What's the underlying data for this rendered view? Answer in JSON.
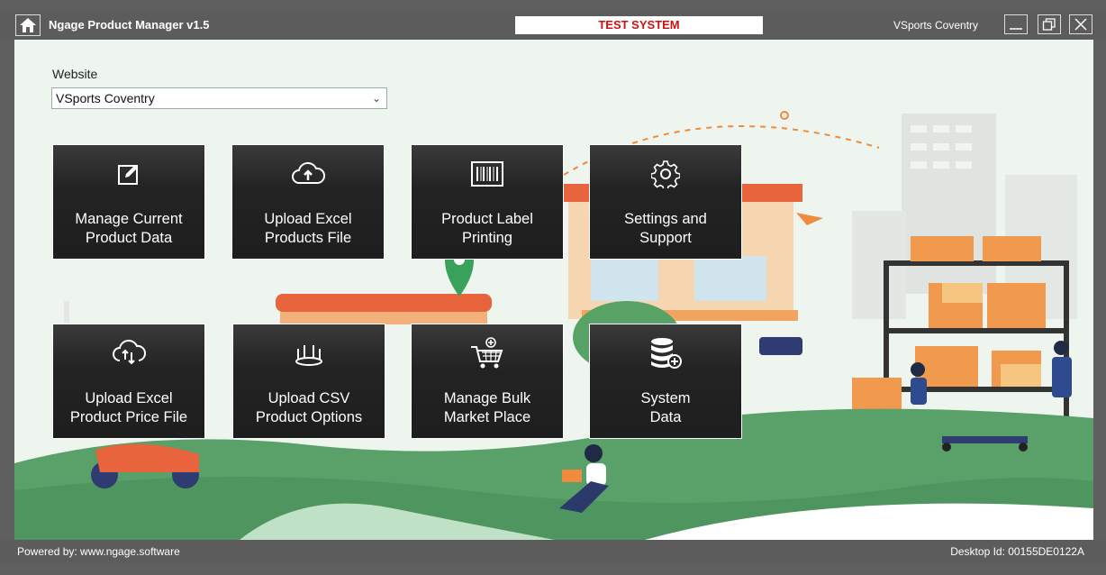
{
  "titlebar": {
    "app_title": "Ngage Product Manager v1.5",
    "test_banner": "TEST SYSTEM",
    "site_name": "VSports Coventry"
  },
  "form": {
    "website_label": "Website",
    "website_value": "VSports Coventry"
  },
  "tiles": [
    {
      "label": "Manage Current\nProduct Data",
      "icon": "edit-icon"
    },
    {
      "label": "Upload Excel\nProducts File",
      "icon": "cloud-upload-icon"
    },
    {
      "label": "Product Label\nPrinting",
      "icon": "barcode-icon"
    },
    {
      "label": "Settings and\nSupport",
      "icon": "gear-icon"
    },
    {
      "label": "Upload Excel\nProduct Price File",
      "icon": "cloud-sync-icon"
    },
    {
      "label": "Upload CSV\nProduct Options",
      "icon": "options-icon"
    },
    {
      "label": "Manage Bulk\nMarket Place",
      "icon": "cart-icon"
    },
    {
      "label": "System\nData",
      "icon": "database-icon"
    }
  ],
  "statusbar": {
    "powered_by": "Powered by: www.ngage.software",
    "desktop_id": "Desktop Id: 00155DE0122A"
  },
  "colors": {
    "titlebar": "#5c5c5c",
    "test_text": "#d01010",
    "tile_bg": "#232323",
    "background": "#eef5ef",
    "grass": "#5aa169"
  }
}
